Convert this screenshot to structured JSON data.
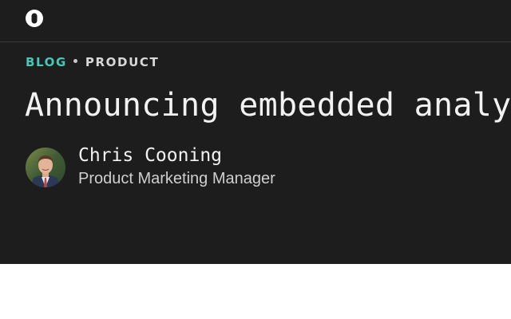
{
  "header": {
    "logo_icon": "circle-ring-logo-icon"
  },
  "article": {
    "breadcrumb": {
      "section": "BLOG",
      "category": "PRODUCT"
    },
    "title": "Announcing embedded analytics",
    "author": {
      "name": "Chris Cooning",
      "role": "Product Marketing Manager"
    }
  },
  "colors": {
    "background": "#1d1d1d",
    "accent": "#47c7b5",
    "text": "#f2f2f2",
    "muted_text": "#cfcfcf"
  }
}
